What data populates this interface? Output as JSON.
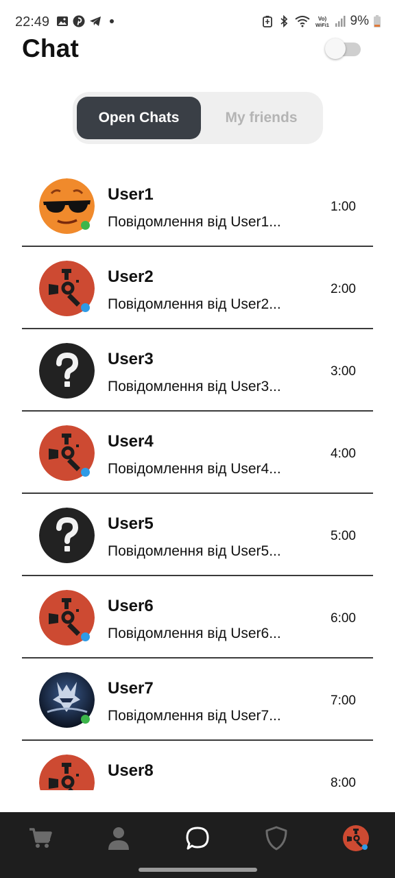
{
  "status_bar": {
    "time": "22:49",
    "battery": "9%",
    "left_icons": [
      "gallery-icon",
      "pinterest-icon",
      "telegram-icon",
      "dot-icon"
    ],
    "right_icons": [
      "battery-saver-icon",
      "bluetooth-icon",
      "wifi-icon",
      "vowifi-icon",
      "signal-icon",
      "battery-icon"
    ]
  },
  "header": {
    "title": "Chat",
    "toggle_on": false
  },
  "tabs": [
    {
      "label": "Open Chats",
      "active": true
    },
    {
      "label": "My friends",
      "active": false
    }
  ],
  "chats": [
    {
      "name": "User1",
      "message": "Повідомлення від User1...",
      "time": "1:00",
      "avatar": "sunglasses-emoji",
      "status_color": "#3cb54a"
    },
    {
      "name": "User2",
      "message": "Повідомлення від User2...",
      "time": "2:00",
      "avatar": "rust-logo",
      "status_color": "#2f9be6"
    },
    {
      "name": "User3",
      "message": "Повідомлення від User3...",
      "time": "3:00",
      "avatar": "question-mark",
      "status_color": ""
    },
    {
      "name": "User4",
      "message": "Повідомлення від User4...",
      "time": "4:00",
      "avatar": "rust-logo",
      "status_color": "#2f9be6"
    },
    {
      "name": "User5",
      "message": "Повідомлення від User5...",
      "time": "5:00",
      "avatar": "question-mark",
      "status_color": ""
    },
    {
      "name": "User6",
      "message": "Повідомлення від User6...",
      "time": "6:00",
      "avatar": "rust-logo",
      "status_color": "#2f9be6"
    },
    {
      "name": "User7",
      "message": "Повідомлення від User7...",
      "time": "7:00",
      "avatar": "gamer-picture",
      "status_color": "#3cb54a"
    },
    {
      "name": "User8",
      "message": "",
      "time": "8:00",
      "avatar": "rust-logo",
      "status_color": ""
    }
  ],
  "bottom_nav": [
    {
      "icon": "cart-icon",
      "active": false
    },
    {
      "icon": "person-icon",
      "active": false
    },
    {
      "icon": "chat-bubble-icon",
      "active": true
    },
    {
      "icon": "shield-icon",
      "active": false
    },
    {
      "icon": "profile-avatar-icon",
      "active": false
    }
  ],
  "colors": {
    "tab_active_bg": "#3a3f46",
    "tab_inactive_text": "#b4b4b4",
    "nav_bg": "#1e1e1e",
    "rust_red": "#cd4a32",
    "online_green": "#3cb54a",
    "online_blue": "#2f9be6"
  }
}
